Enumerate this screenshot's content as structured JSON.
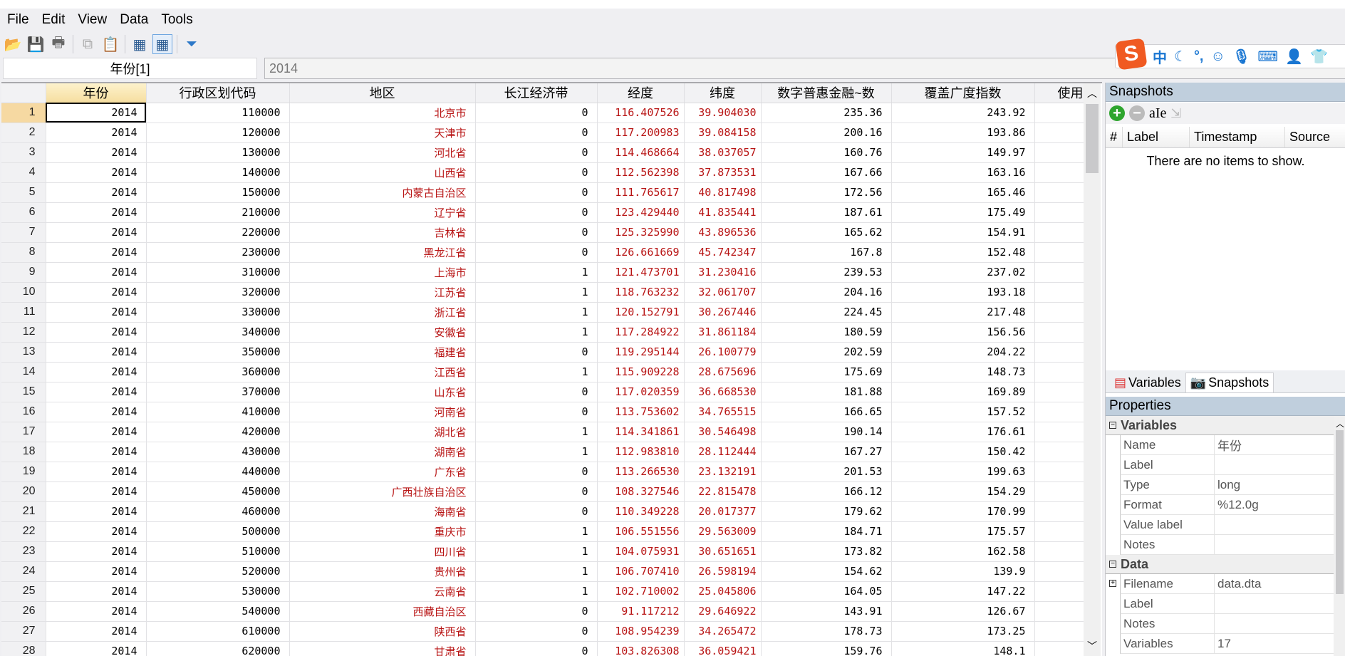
{
  "menu": [
    "File",
    "Edit",
    "View",
    "Data",
    "Tools"
  ],
  "toolbar": {
    "icons": [
      "open-icon",
      "save-icon",
      "print-icon",
      "copy-icon",
      "paste-icon",
      "data-editor-icon",
      "data-browser-icon",
      "filter-icon"
    ]
  },
  "varbar": {
    "name": "年份[1]",
    "value": "2014"
  },
  "ime": {
    "mode": "中",
    "punct": "°,"
  },
  "columns": [
    "年份",
    "行政区划代码",
    "地区",
    "长江经济带",
    "经度",
    "纬度",
    "数字普惠金融~数",
    "覆盖广度指数",
    "使用"
  ],
  "rows": [
    [
      "2014",
      "110000",
      "北京市",
      "0",
      "116.407526",
      "39.904030",
      "235.36",
      "243.92"
    ],
    [
      "2014",
      "120000",
      "天津市",
      "0",
      "117.200983",
      "39.084158",
      "200.16",
      "193.86"
    ],
    [
      "2014",
      "130000",
      "河北省",
      "0",
      "114.468664",
      "38.037057",
      "160.76",
      "149.97"
    ],
    [
      "2014",
      "140000",
      "山西省",
      "0",
      "112.562398",
      "37.873531",
      "167.66",
      "163.16"
    ],
    [
      "2014",
      "150000",
      "内蒙古自治区",
      "0",
      "111.765617",
      "40.817498",
      "172.56",
      "165.46"
    ],
    [
      "2014",
      "210000",
      "辽宁省",
      "0",
      "123.429440",
      "41.835441",
      "187.61",
      "175.49"
    ],
    [
      "2014",
      "220000",
      "吉林省",
      "0",
      "125.325990",
      "43.896536",
      "165.62",
      "154.91"
    ],
    [
      "2014",
      "230000",
      "黑龙江省",
      "0",
      "126.661669",
      "45.742347",
      "167.8",
      "152.48"
    ],
    [
      "2014",
      "310000",
      "上海市",
      "1",
      "121.473701",
      "31.230416",
      "239.53",
      "237.02"
    ],
    [
      "2014",
      "320000",
      "江苏省",
      "1",
      "118.763232",
      "32.061707",
      "204.16",
      "193.18"
    ],
    [
      "2014",
      "330000",
      "浙江省",
      "1",
      "120.152791",
      "30.267446",
      "224.45",
      "217.48"
    ],
    [
      "2014",
      "340000",
      "安徽省",
      "1",
      "117.284922",
      "31.861184",
      "180.59",
      "156.56"
    ],
    [
      "2014",
      "350000",
      "福建省",
      "0",
      "119.295144",
      "26.100779",
      "202.59",
      "204.22"
    ],
    [
      "2014",
      "360000",
      "江西省",
      "1",
      "115.909228",
      "28.675696",
      "175.69",
      "148.73"
    ],
    [
      "2014",
      "370000",
      "山东省",
      "0",
      "117.020359",
      "36.668530",
      "181.88",
      "169.89"
    ],
    [
      "2014",
      "410000",
      "河南省",
      "0",
      "113.753602",
      "34.765515",
      "166.65",
      "157.52"
    ],
    [
      "2014",
      "420000",
      "湖北省",
      "1",
      "114.341861",
      "30.546498",
      "190.14",
      "176.61"
    ],
    [
      "2014",
      "430000",
      "湖南省",
      "1",
      "112.983810",
      "28.112444",
      "167.27",
      "150.42"
    ],
    [
      "2014",
      "440000",
      "广东省",
      "0",
      "113.266530",
      "23.132191",
      "201.53",
      "199.63"
    ],
    [
      "2014",
      "450000",
      "广西壮族自治区",
      "0",
      "108.327546",
      "22.815478",
      "166.12",
      "154.29"
    ],
    [
      "2014",
      "460000",
      "海南省",
      "0",
      "110.349228",
      "20.017377",
      "179.62",
      "170.99"
    ],
    [
      "2014",
      "500000",
      "重庆市",
      "1",
      "106.551556",
      "29.563009",
      "184.71",
      "175.57"
    ],
    [
      "2014",
      "510000",
      "四川省",
      "1",
      "104.075931",
      "30.651651",
      "173.82",
      "162.58"
    ],
    [
      "2014",
      "520000",
      "贵州省",
      "1",
      "106.707410",
      "26.598194",
      "154.62",
      "139.9"
    ],
    [
      "2014",
      "530000",
      "云南省",
      "1",
      "102.710002",
      "25.045806",
      "164.05",
      "147.22"
    ],
    [
      "2014",
      "540000",
      "西藏自治区",
      "0",
      "91.117212",
      "29.646922",
      "143.91",
      "126.67"
    ],
    [
      "2014",
      "610000",
      "陕西省",
      "0",
      "108.954239",
      "34.265472",
      "178.73",
      "173.25"
    ],
    [
      "2014",
      "620000",
      "甘肃省",
      "0",
      "103.826308",
      "36.059421",
      "159.76",
      "148.1"
    ]
  ],
  "snapshots": {
    "title": "Snapshots",
    "columns": [
      "#",
      "Label",
      "Timestamp",
      "Source"
    ],
    "empty": "There are no items to show."
  },
  "tabs": [
    "Variables",
    "Snapshots"
  ],
  "properties": {
    "title": "Properties",
    "groups": [
      {
        "name": "Variables",
        "rows": [
          [
            "Name",
            "年份"
          ],
          [
            "Label",
            ""
          ],
          [
            "Type",
            "long"
          ],
          [
            "Format",
            "%12.0g"
          ],
          [
            "Value label",
            ""
          ],
          [
            "Notes",
            ""
          ]
        ]
      },
      {
        "name": "Data",
        "rows": [
          [
            "Filename",
            "data.dta"
          ],
          [
            "Label",
            ""
          ],
          [
            "Notes",
            ""
          ],
          [
            "Variables",
            "17"
          ]
        ]
      }
    ]
  },
  "colors": {
    "string_red": "#b81414",
    "panel_header": "#c0cfdd",
    "selected": "#f6d9a2"
  }
}
